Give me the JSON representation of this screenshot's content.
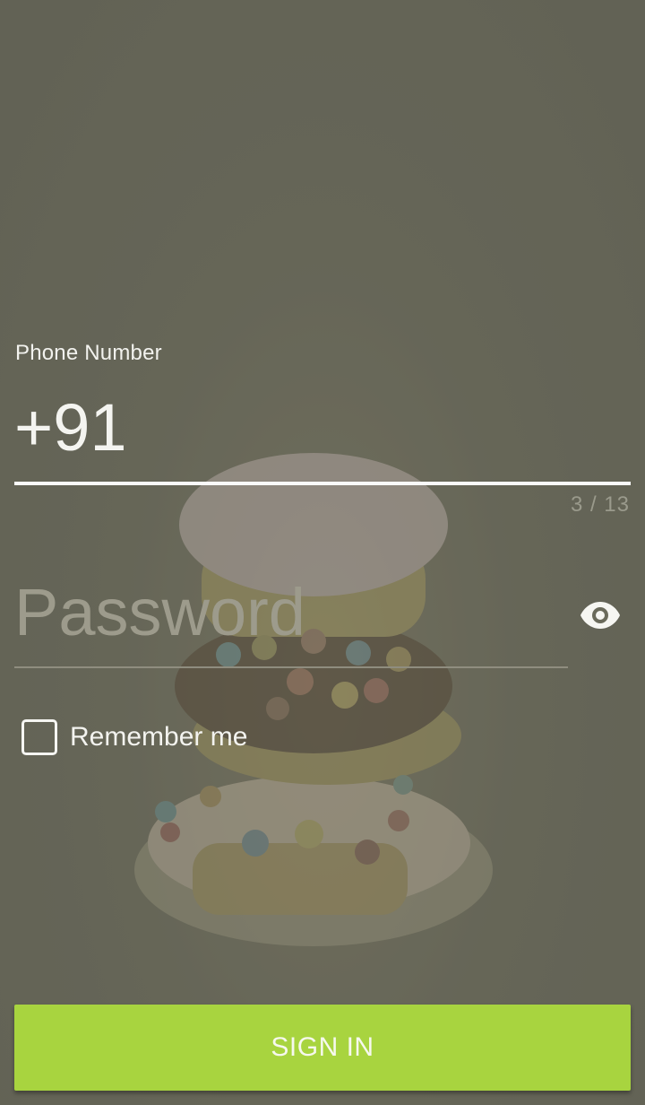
{
  "login_form": {
    "phone_label": "Phone Number",
    "phone_value": "+91",
    "phone_counter": "3 / 13",
    "password_placeholder": "Password",
    "password_value": "",
    "remember_label": "Remember me",
    "remember_checked": false,
    "signin_label": "SIGN IN"
  },
  "icons": {
    "password_toggle": "eye-icon",
    "background": "cupcakes-illustration"
  },
  "colors": {
    "accent": "#A8D43F",
    "background": "#676759",
    "text": "#F2F2EE",
    "hint": "#9D9B8C"
  }
}
